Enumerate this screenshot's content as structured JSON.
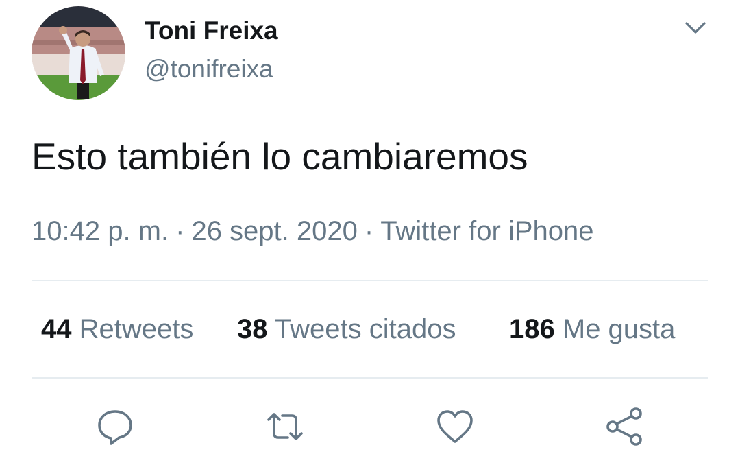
{
  "author": {
    "display_name": "Toni Freixa",
    "handle": "@tonifreixa"
  },
  "tweet": {
    "text": "Esto también lo cambiaremos",
    "time": "10:42 p. m.",
    "separator": "·",
    "date": "26 sept. 2020",
    "source": "Twitter for iPhone"
  },
  "stats": {
    "retweets": {
      "count": "44",
      "label": "Retweets"
    },
    "quotes": {
      "count": "38",
      "label": "Tweets citados"
    },
    "likes": {
      "count": "186",
      "label": "Me gusta"
    }
  },
  "icons": {
    "menu": "chevron-down-icon",
    "reply": "reply-icon",
    "retweet": "retweet-icon",
    "like": "heart-icon",
    "share": "share-icon"
  },
  "colors": {
    "text_primary": "#14171a",
    "text_secondary": "#657786",
    "divider": "#e6ecf0",
    "icon": "#657786"
  }
}
